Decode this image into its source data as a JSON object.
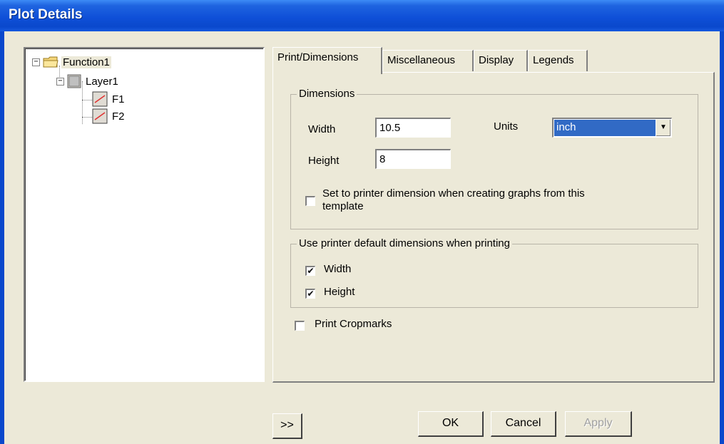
{
  "window": {
    "title": "Plot Details"
  },
  "tree": {
    "root": {
      "label": "Function1",
      "expander": "−"
    },
    "layer": {
      "label": "Layer1",
      "expander": "−"
    },
    "plots": [
      {
        "label": "F1"
      },
      {
        "label": "F2"
      }
    ]
  },
  "tabs": [
    {
      "label": "Print/Dimensions",
      "active": true
    },
    {
      "label": "Miscellaneous"
    },
    {
      "label": "Display"
    },
    {
      "label": "Legends"
    }
  ],
  "dimensions": {
    "group_title": "Dimensions",
    "width_label": "Width",
    "width_value": "10.5",
    "height_label": "Height",
    "height_value": "8",
    "units_label": "Units",
    "units_value": "inch",
    "printer_dim_label": "Set to printer dimension when creating graphs from this template",
    "printer_dim_checked": false
  },
  "printer_defaults": {
    "group_title": "Use printer default dimensions when printing",
    "width_label": "Width",
    "width_checked": true,
    "height_label": "Height",
    "height_checked": true
  },
  "cropmarks": {
    "label": "Print Cropmarks",
    "checked": false
  },
  "buttons": {
    "expand": ">>",
    "ok": "OK",
    "cancel": "Cancel",
    "apply": "Apply"
  }
}
